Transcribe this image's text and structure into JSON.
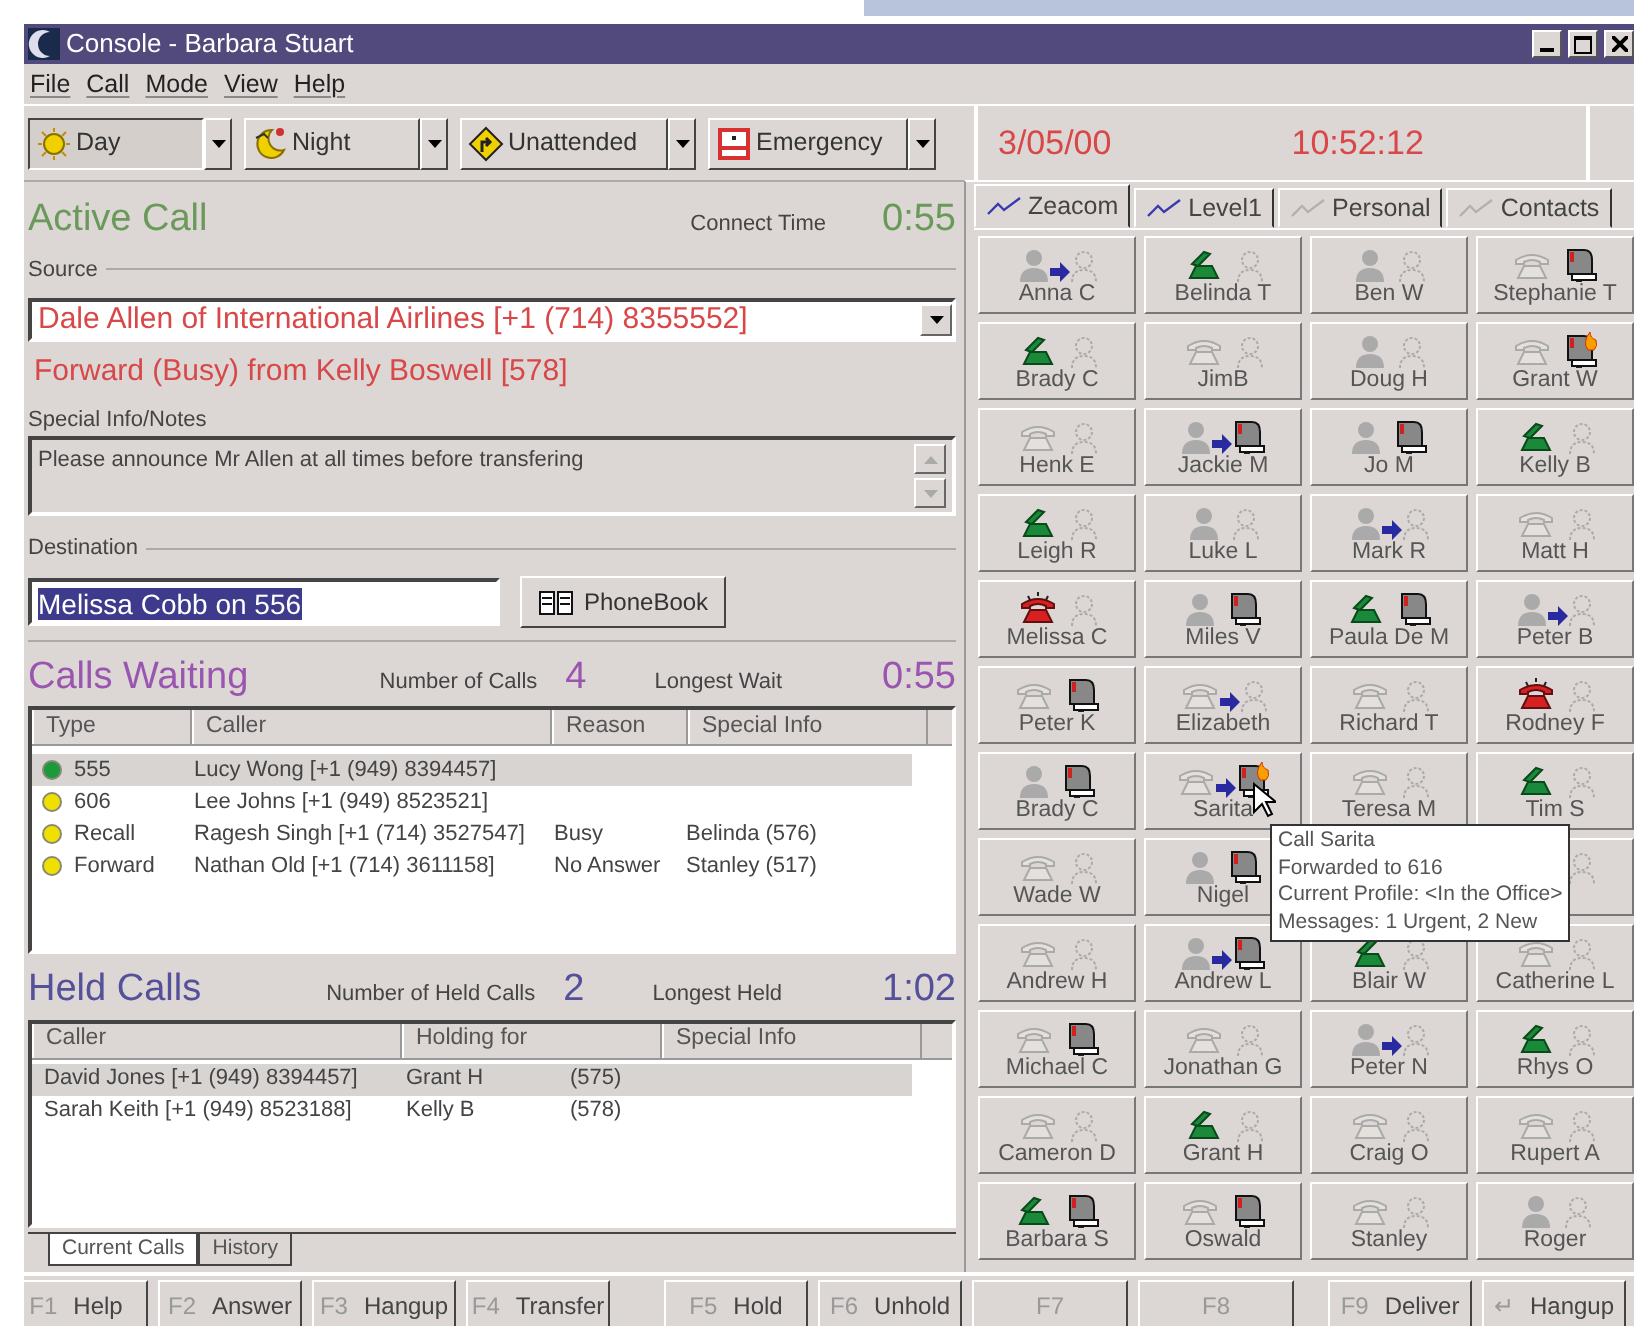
{
  "window": {
    "title": "Console - Barbara Stuart"
  },
  "menu": [
    "File",
    "Call",
    "Mode",
    "View",
    "Help"
  ],
  "modes": [
    {
      "label": "Day",
      "selected": true
    },
    {
      "label": "Night",
      "selected": false
    },
    {
      "label": "Unattended",
      "selected": false
    },
    {
      "label": "Emergency",
      "selected": false
    }
  ],
  "clock": {
    "date": "3/05/00",
    "time": "10:52:12"
  },
  "active_call": {
    "title": "Active Call",
    "connect_label": "Connect Time",
    "connect_time": "0:55",
    "source_label": "Source",
    "source": "Dale Allen of International Airlines [+1 (714) 8355552]",
    "forward_info": "Forward (Busy) from Kelly Boswell [578]",
    "notes_label": "Special Info/Notes",
    "notes": "Please announce Mr Allen at all times before transfering",
    "destination_label": "Destination",
    "destination": "Melissa Cobb on 556",
    "phonebook_button": "PhoneBook"
  },
  "calls_waiting": {
    "title": "Calls Waiting",
    "count_label": "Number of Calls",
    "count": "4",
    "wait_label": "Longest Wait",
    "wait": "0:55",
    "columns": [
      "Type",
      "Caller",
      "Reason",
      "Special Info"
    ],
    "rows": [
      {
        "color": "#1a9a3a",
        "type": "555",
        "caller": "Lucy Wong [+1 (949) 8394457]",
        "selected": true
      },
      {
        "color": "#f0e000",
        "type": "606",
        "caller": "Lee Johns [+1 (949) 8523521]",
        "selected": false
      },
      {
        "color": "#f0e000",
        "type": "Recall",
        "caller": "Ragesh Singh [+1 (714) 3527547]",
        "reason": "Busy",
        "special": "Belinda (576)",
        "selected": false
      },
      {
        "color": "#f0e000",
        "type": "Forward",
        "caller": "Nathan Old [+1 (714) 3611158]",
        "reason": "No Answer",
        "special": "Stanley (517)",
        "selected": false
      }
    ]
  },
  "held_calls": {
    "title": "Held Calls",
    "count_label": "Number of Held Calls",
    "count": "2",
    "held_label": "Longest Held",
    "held": "1:02",
    "columns": [
      "Caller",
      "Holding for",
      "Special Info"
    ],
    "rows": [
      {
        "caller": "David Jones [+1 (949) 8394457]",
        "holding_for": "Grant H",
        "extension": "(575)",
        "selected": true
      },
      {
        "caller": "Sarah Keith [+1 (949) 8523188]",
        "holding_for": "Kelly B",
        "extension": "(578)",
        "selected": false
      }
    ]
  },
  "bottom_tabs": [
    {
      "label": "Current Calls",
      "selected": true
    },
    {
      "label": "History",
      "selected": false
    }
  ],
  "directory_tabs": [
    {
      "label": "Zeacom",
      "selected": true,
      "color": "#3a3ab0"
    },
    {
      "label": "Level1",
      "selected": false,
      "color": "#3a3ab0"
    },
    {
      "label": "Personal",
      "selected": false,
      "color": "#b4b0ac"
    },
    {
      "label": "Contacts",
      "selected": false,
      "color": "#b4b0ac"
    }
  ],
  "contacts": [
    {
      "name": "Anna C",
      "kind": "away",
      "forwarded": true,
      "mail": false,
      "urgent": false
    },
    {
      "name": "Belinda T",
      "kind": "offhook",
      "forwarded": false,
      "mail": false,
      "urgent": false
    },
    {
      "name": "Ben W",
      "kind": "away",
      "forwarded": false,
      "mail": false,
      "urgent": false
    },
    {
      "name": "Stephanie T",
      "kind": "idle",
      "forwarded": false,
      "mail": true,
      "urgent": false
    },
    {
      "name": "Brady C",
      "kind": "offhook",
      "forwarded": false,
      "mail": false,
      "urgent": false
    },
    {
      "name": "JimB",
      "kind": "idle",
      "forwarded": false,
      "mail": false,
      "urgent": false
    },
    {
      "name": "Doug H",
      "kind": "away",
      "forwarded": false,
      "mail": false,
      "urgent": false
    },
    {
      "name": "Grant W",
      "kind": "idle",
      "forwarded": false,
      "mail": true,
      "urgent": true
    },
    {
      "name": "Henk E",
      "kind": "idle",
      "forwarded": false,
      "mail": false,
      "urgent": false
    },
    {
      "name": "Jackie M",
      "kind": "away",
      "forwarded": true,
      "mail": true,
      "urgent": false
    },
    {
      "name": "Jo M",
      "kind": "away",
      "forwarded": false,
      "mail": true,
      "urgent": false
    },
    {
      "name": "Kelly B",
      "kind": "offhook",
      "forwarded": false,
      "mail": false,
      "urgent": false
    },
    {
      "name": "Leigh R",
      "kind": "offhook",
      "forwarded": false,
      "mail": false,
      "urgent": false
    },
    {
      "name": "Luke L",
      "kind": "away",
      "forwarded": false,
      "mail": false,
      "urgent": false
    },
    {
      "name": "Mark R",
      "kind": "away",
      "forwarded": true,
      "mail": false,
      "urgent": false
    },
    {
      "name": "Matt H",
      "kind": "idle",
      "forwarded": false,
      "mail": false,
      "urgent": false
    },
    {
      "name": "Melissa C",
      "kind": "ringing",
      "forwarded": false,
      "mail": false,
      "urgent": false
    },
    {
      "name": "Miles V",
      "kind": "away",
      "forwarded": false,
      "mail": true,
      "urgent": false
    },
    {
      "name": "Paula De M",
      "kind": "offhook",
      "forwarded": false,
      "mail": true,
      "urgent": false
    },
    {
      "name": "Peter B",
      "kind": "away",
      "forwarded": true,
      "mail": false,
      "urgent": false
    },
    {
      "name": "Peter K",
      "kind": "idle",
      "forwarded": false,
      "mail": true,
      "urgent": false
    },
    {
      "name": "Elizabeth",
      "kind": "idle",
      "forwarded": true,
      "mail": false,
      "urgent": false
    },
    {
      "name": "Richard T",
      "kind": "idle",
      "forwarded": false,
      "mail": false,
      "urgent": false
    },
    {
      "name": "Rodney F",
      "kind": "ringing",
      "forwarded": false,
      "mail": false,
      "urgent": false
    },
    {
      "name": "Brady C",
      "kind": "away",
      "forwarded": false,
      "mail": true,
      "urgent": false
    },
    {
      "name": "Sarita",
      "kind": "idle",
      "forwarded": true,
      "mail": true,
      "urgent": true
    },
    {
      "name": "Teresa M",
      "kind": "idle",
      "forwarded": false,
      "mail": false,
      "urgent": false
    },
    {
      "name": "Tim S",
      "kind": "offhook",
      "forwarded": false,
      "mail": false,
      "urgent": false
    },
    {
      "name": "Wade W",
      "kind": "idle",
      "forwarded": false,
      "mail": false,
      "urgent": false
    },
    {
      "name": "Nigel",
      "kind": "away",
      "forwarded": false,
      "mail": true,
      "urgent": false
    },
    {
      "forwarded": false,
      "mail": false,
      "urgent": false
    },
    {
      "name": "Andrew H",
      "kind": "idle",
      "forwarded": false,
      "mail": false,
      "urgent": false
    },
    {
      "name": "Andrew L",
      "kind": "away",
      "forwarded": true,
      "mail": true,
      "urgent": false
    },
    {
      "name": "Blair W",
      "kind": "offhook",
      "forwarded": false,
      "mail": false,
      "urgent": false
    },
    {
      "name": "Catherine L",
      "kind": "idle",
      "forwarded": false,
      "mail": false,
      "urgent": false
    },
    {
      "name": "Michael C",
      "kind": "idle",
      "forwarded": false,
      "mail": true,
      "urgent": false
    },
    {
      "name": "Jonathan G",
      "kind": "idle",
      "forwarded": false,
      "mail": false,
      "urgent": false
    },
    {
      "name": "Peter N",
      "kind": "away",
      "forwarded": true,
      "mail": false,
      "urgent": false
    },
    {
      "name": "Rhys O",
      "kind": "offhook",
      "forwarded": false,
      "mail": false,
      "urgent": false
    },
    {
      "name": "Cameron D",
      "kind": "idle",
      "forwarded": false,
      "mail": false,
      "urgent": false
    },
    {
      "name": "Grant H",
      "kind": "offhook",
      "forwarded": false,
      "mail": false,
      "urgent": false
    },
    {
      "name": "Craig O",
      "kind": "idle",
      "forwarded": false,
      "mail": false,
      "urgent": false
    },
    {
      "name": "Rupert A",
      "kind": "idle",
      "forwarded": false,
      "mail": false,
      "urgent": false
    },
    {
      "name": "Barbara S",
      "kind": "offhook",
      "forwarded": false,
      "mail": true,
      "urgent": false
    },
    {
      "name": "Oswald",
      "kind": "idle",
      "forwarded": false,
      "mail": true,
      "urgent": false
    },
    {
      "name": "Stanley",
      "kind": "idle",
      "forwarded": false,
      "mail": false,
      "urgent": false
    },
    {
      "name": "Roger",
      "kind": "away",
      "forwarded": false,
      "mail": false,
      "urgent": false
    }
  ],
  "tooltip": {
    "lines": [
      "Call Sarita",
      "Forwarded to 616",
      "Current Profile: <In the Office>",
      "Messages: 1 Urgent, 2 New"
    ]
  },
  "function_keys": [
    {
      "key": "F1",
      "label": "Help"
    },
    {
      "key": "F2",
      "label": "Answer"
    },
    {
      "key": "F3",
      "label": "Hangup"
    },
    {
      "key": "F4",
      "label": "Transfer"
    },
    {
      "key": "F5",
      "label": "Hold"
    },
    {
      "key": "F6",
      "label": "Unhold"
    },
    {
      "key": "F7"
    },
    {
      "key": "F8"
    },
    {
      "key": "F9",
      "label": "Deliver"
    },
    {
      "key": "↵",
      "label": "Hangup"
    }
  ]
}
